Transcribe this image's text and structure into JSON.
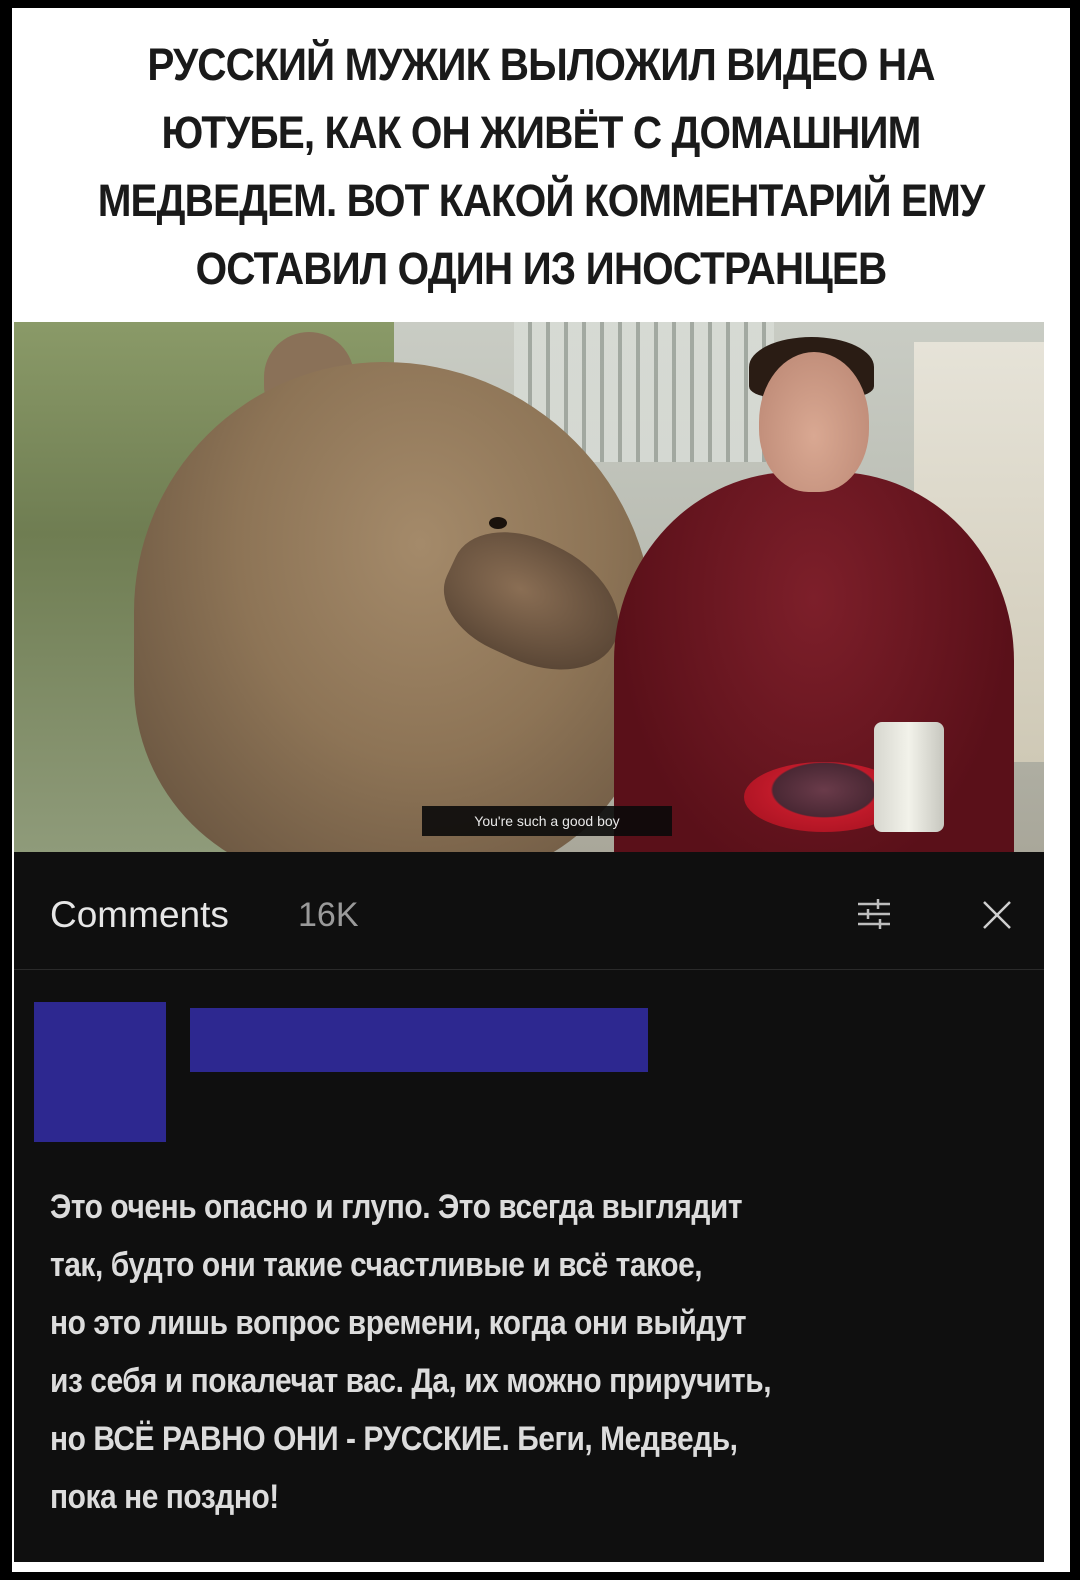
{
  "caption": "Русский мужик выложил видео на ютубе, как он живёт с домашним медведем. Вот какой комментарий ему оставил один из иностранцев",
  "video": {
    "subtitle": "You're such a good boy"
  },
  "comments_panel": {
    "title": "Comments",
    "count": "16K",
    "filter_icon": "sort-filter-icon",
    "close_icon": "close-icon",
    "avatar_color": "#2d2890",
    "comment_text": "Это очень опасно и глупо. Это всегда выглядит\nтак, будто они такие счастливые и всё такое,\nно это лишь вопрос времени, когда они выйдут\nиз себя и покалечат вас. Да, их можно приручить,\nно ВСЁ РАВНО ОНИ - РУССКИЕ. Беги, Медведь,\nпока не поздно!"
  }
}
